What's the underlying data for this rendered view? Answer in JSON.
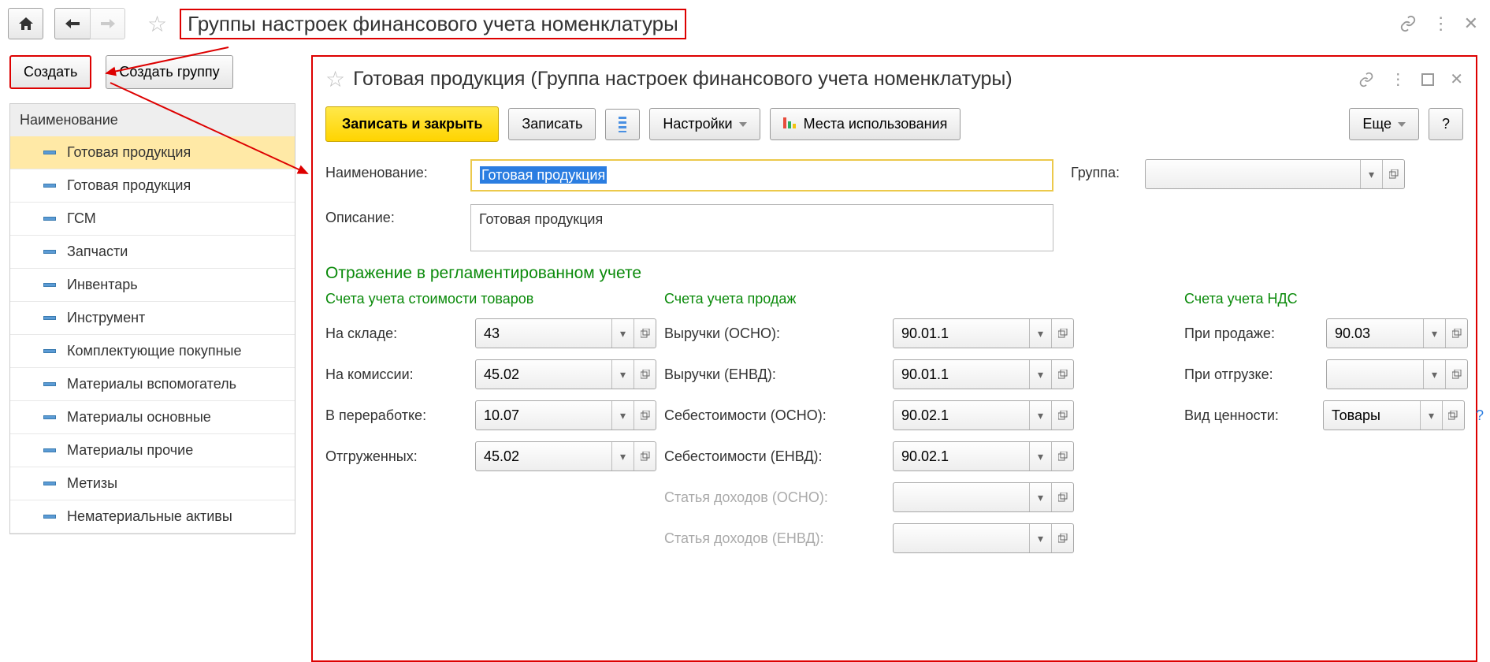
{
  "header": {
    "title": "Группы настроек финансового учета номенклатуры"
  },
  "left_toolbar": {
    "create": "Создать",
    "create_group": "Создать группу"
  },
  "list": {
    "header": "Наименование",
    "items": [
      "Готовая продукция",
      "Готовая продукция",
      "ГСМ",
      "Запчасти",
      "Инвентарь",
      "Инструмент",
      "Комплектующие покупные",
      "Материалы вспомогатель",
      "Материалы основные",
      "Материалы прочие",
      "Метизы",
      "Нематериальные активы"
    ]
  },
  "child": {
    "title": "Готовая продукция (Группа настроек финансового учета номенклатуры)",
    "toolbar": {
      "save_close": "Записать и закрыть",
      "save": "Записать",
      "settings": "Настройки",
      "usage": "Места использования",
      "more": "Еще",
      "help": "?"
    },
    "form": {
      "name_label": "Наименование:",
      "name_value": "Готовая продукция",
      "desc_label": "Описание:",
      "desc_value": "Готовая продукция",
      "group_label": "Группа:",
      "group_value": ""
    },
    "section_title": "Отражение в регламентированном учете",
    "subsections": {
      "cost": "Счета учета стоимости товаров",
      "sales": "Счета учета продаж",
      "vat": "Счета учета НДС"
    },
    "accounts": {
      "cost": [
        {
          "label": "На складе:",
          "value": "43"
        },
        {
          "label": "На комиссии:",
          "value": "45.02"
        },
        {
          "label": "В переработке:",
          "value": "10.07"
        },
        {
          "label": "Отгруженных:",
          "value": "45.02"
        }
      ],
      "sales": [
        {
          "label": "Выручки (ОСНО):",
          "value": "90.01.1"
        },
        {
          "label": "Выручки (ЕНВД):",
          "value": "90.01.1"
        },
        {
          "label": "Себестоимости (ОСНО):",
          "value": "90.02.1"
        },
        {
          "label": "Себестоимости (ЕНВД):",
          "value": "90.02.1"
        },
        {
          "label": "Статья доходов (ОСНО):",
          "value": "",
          "muted": true
        },
        {
          "label": "Статья доходов (ЕНВД):",
          "value": "",
          "muted": true
        }
      ],
      "vat": [
        {
          "label": "При продаже:",
          "value": "90.03"
        },
        {
          "label": "При отгрузке:",
          "value": ""
        },
        {
          "label": "Вид ценности:",
          "value": "Товары",
          "help": true
        }
      ]
    }
  }
}
